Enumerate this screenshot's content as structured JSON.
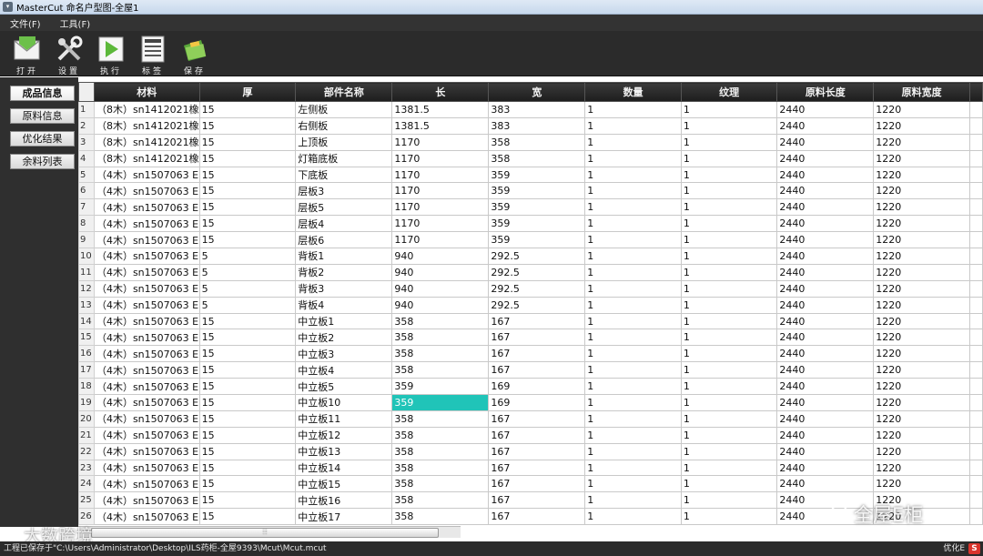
{
  "window": {
    "title": "MasterCut 命名户型图-全屋1"
  },
  "menu": [
    "文件(F)",
    "工具(F)"
  ],
  "toolbar": [
    {
      "label": "打开",
      "icon": "open-mail-icon"
    },
    {
      "label": "设置",
      "icon": "tools-icon"
    },
    {
      "label": "执行",
      "icon": "play-icon"
    },
    {
      "label": "标签",
      "icon": "label-icon"
    },
    {
      "label": "保存",
      "icon": "save-icon"
    }
  ],
  "sidebar": [
    "成品信息",
    "原料信息",
    "优化结果",
    "余料列表"
  ],
  "table": {
    "columns": [
      "材料",
      "厚",
      "部件名称",
      "长",
      "宽",
      "数量",
      "纹理",
      "原料长度",
      "原料宽度"
    ],
    "rows": [
      [
        "1",
        "（8木）sn1412021橡",
        "15",
        "左侧板",
        "1381.5",
        "383",
        "1",
        "1",
        "2440",
        "1220"
      ],
      [
        "2",
        "（8木）sn1412021橡",
        "15",
        "右侧板",
        "1381.5",
        "383",
        "1",
        "1",
        "2440",
        "1220"
      ],
      [
        "3",
        "（8木）sn1412021橡",
        "15",
        "上顶板",
        "1170",
        "358",
        "1",
        "1",
        "2440",
        "1220"
      ],
      [
        "4",
        "（8木）sn1412021橡",
        "15",
        "灯箱底板",
        "1170",
        "358",
        "1",
        "1",
        "2440",
        "1220"
      ],
      [
        "5",
        "（4木）sn1507063 E",
        "15",
        "下底板",
        "1170",
        "359",
        "1",
        "1",
        "2440",
        "1220"
      ],
      [
        "6",
        "（4木）sn1507063 E",
        "15",
        "层板3",
        "1170",
        "359",
        "1",
        "1",
        "2440",
        "1220"
      ],
      [
        "7",
        "（4木）sn1507063 E",
        "15",
        "层板5",
        "1170",
        "359",
        "1",
        "1",
        "2440",
        "1220"
      ],
      [
        "8",
        "（4木）sn1507063 E",
        "15",
        "层板4",
        "1170",
        "359",
        "1",
        "1",
        "2440",
        "1220"
      ],
      [
        "9",
        "（4木）sn1507063 E",
        "15",
        "层板6",
        "1170",
        "359",
        "1",
        "1",
        "2440",
        "1220"
      ],
      [
        "10",
        "（4木）sn1507063 E",
        "5",
        "背板1",
        "940",
        "292.5",
        "1",
        "1",
        "2440",
        "1220"
      ],
      [
        "11",
        "（4木）sn1507063 E",
        "5",
        "背板2",
        "940",
        "292.5",
        "1",
        "1",
        "2440",
        "1220"
      ],
      [
        "12",
        "（4木）sn1507063 E",
        "5",
        "背板3",
        "940",
        "292.5",
        "1",
        "1",
        "2440",
        "1220"
      ],
      [
        "13",
        "（4木）sn1507063 E",
        "5",
        "背板4",
        "940",
        "292.5",
        "1",
        "1",
        "2440",
        "1220"
      ],
      [
        "14",
        "（4木）sn1507063 E",
        "15",
        "中立板1",
        "358",
        "167",
        "1",
        "1",
        "2440",
        "1220"
      ],
      [
        "15",
        "（4木）sn1507063 E",
        "15",
        "中立板2",
        "358",
        "167",
        "1",
        "1",
        "2440",
        "1220"
      ],
      [
        "16",
        "（4木）sn1507063 E",
        "15",
        "中立板3",
        "358",
        "167",
        "1",
        "1",
        "2440",
        "1220"
      ],
      [
        "17",
        "（4木）sn1507063 E",
        "15",
        "中立板4",
        "358",
        "167",
        "1",
        "1",
        "2440",
        "1220"
      ],
      [
        "18",
        "（4木）sn1507063 E",
        "15",
        "中立板5",
        "359",
        "169",
        "1",
        "1",
        "2440",
        "1220"
      ],
      [
        "19",
        "（4木）sn1507063 E",
        "15",
        "中立板10",
        "359",
        "169",
        "1",
        "1",
        "2440",
        "1220"
      ],
      [
        "20",
        "（4木）sn1507063 E",
        "15",
        "中立板11",
        "358",
        "167",
        "1",
        "1",
        "2440",
        "1220"
      ],
      [
        "21",
        "（4木）sn1507063 E",
        "15",
        "中立板12",
        "358",
        "167",
        "1",
        "1",
        "2440",
        "1220"
      ],
      [
        "22",
        "（4木）sn1507063 E",
        "15",
        "中立板13",
        "358",
        "167",
        "1",
        "1",
        "2440",
        "1220"
      ],
      [
        "23",
        "（4木）sn1507063 E",
        "15",
        "中立板14",
        "358",
        "167",
        "1",
        "1",
        "2440",
        "1220"
      ],
      [
        "24",
        "（4木）sn1507063 E",
        "15",
        "中立板15",
        "358",
        "167",
        "1",
        "1",
        "2440",
        "1220"
      ],
      [
        "25",
        "（4木）sn1507063 E",
        "15",
        "中立板16",
        "358",
        "167",
        "1",
        "1",
        "2440",
        "1220"
      ],
      [
        "26",
        "（4木）sn1507063 E",
        "15",
        "中立板17",
        "358",
        "167",
        "1",
        "1",
        "2440",
        "1220"
      ]
    ],
    "selected_row": 18,
    "selected_col": 4
  },
  "status": {
    "text": "工程已保存于\"C:\\Users\\Administrator\\Desktop\\ILS药柜-全屋9393\\Mcut\\Mcut.mcut",
    "right": "优化E"
  },
  "watermarks": {
    "left": "大数跨境",
    "right": "全屋E柜"
  },
  "colors": {
    "selection": "#20c4b8",
    "toolbar": "#2b2b2b"
  }
}
